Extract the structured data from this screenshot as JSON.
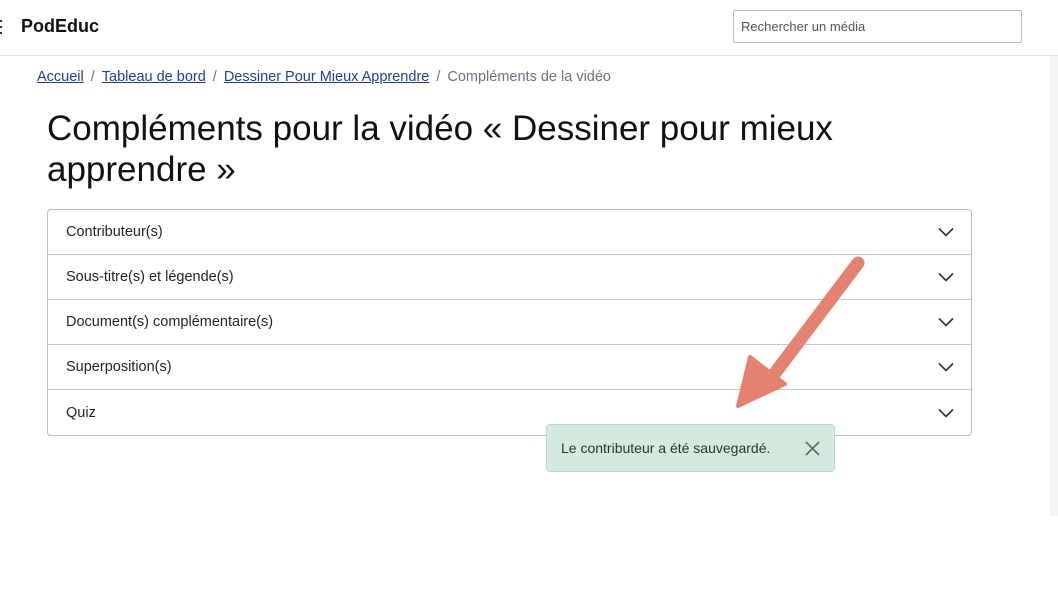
{
  "app": {
    "brand": "PodEduc"
  },
  "search": {
    "placeholder": "Rechercher un média"
  },
  "breadcrumb": {
    "items": [
      {
        "label": "Accueil"
      },
      {
        "label": "Tableau de bord"
      },
      {
        "label": "Dessiner Pour Mieux Apprendre"
      }
    ],
    "current": "Compléments de la vidéo",
    "separator": "/"
  },
  "page": {
    "title": "Compléments pour la vidéo « Dessiner pour mieux apprendre »"
  },
  "accordion": {
    "items": [
      {
        "label": "Contributeur(s)"
      },
      {
        "label": "Sous-titre(s) et légende(s)"
      },
      {
        "label": "Document(s) complémentaire(s)"
      },
      {
        "label": "Superposition(s)"
      },
      {
        "label": "Quiz"
      }
    ]
  },
  "toast": {
    "message": "Le contributeur a été sauvegardé."
  },
  "icons": {
    "accordion_toggle": "chevron-down-icon",
    "toast_close": "close-icon",
    "menu": "hamburger-icon"
  },
  "colors": {
    "link": "#1f3fa0",
    "toast_bg": "#d3eadc",
    "annotation_arrow": "#e5826f"
  }
}
